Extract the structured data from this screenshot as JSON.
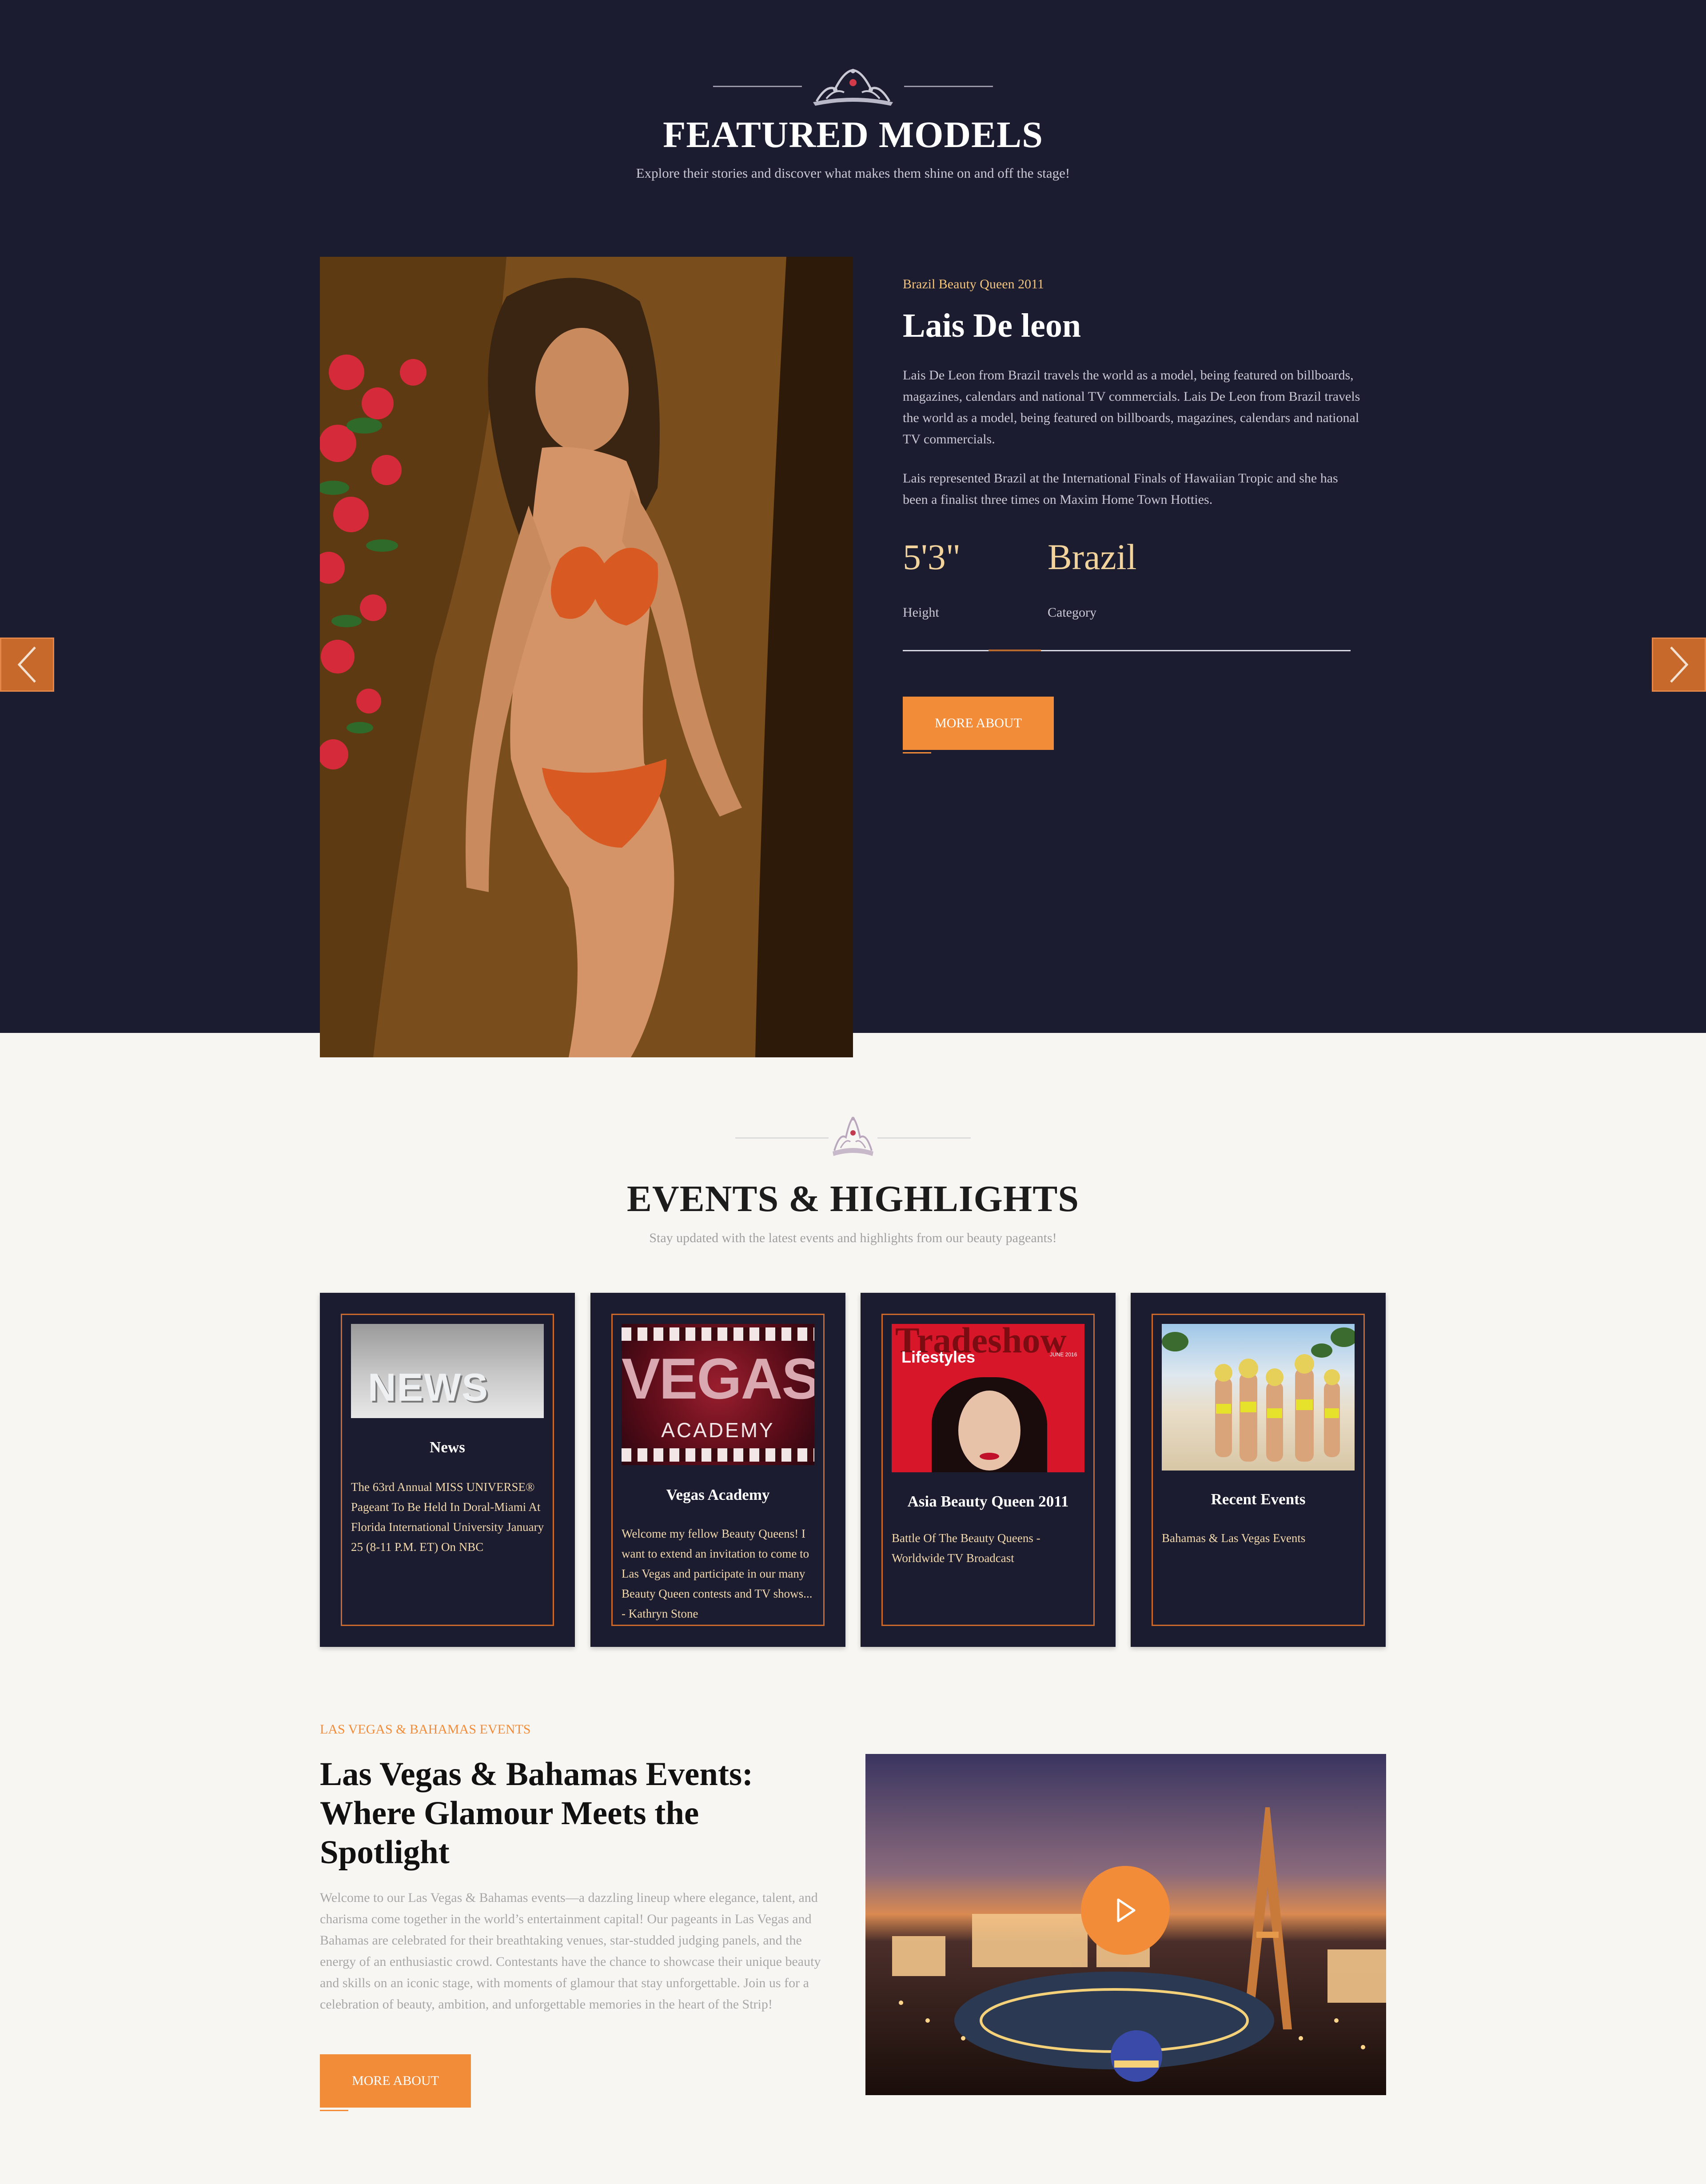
{
  "featured": {
    "title": "FEATURED MODELS",
    "subtitle": "Explore their stories and discover what makes them shine on and off the stage!"
  },
  "model": {
    "kicker": "Brazil Beauty Queen 2011",
    "name": "Lais De leon",
    "bio_1": "Lais De Leon from Brazil travels the world as a model, being featured on billboards, magazines, calendars and national TV commercials. Lais De Leon from Brazil travels the world as a model, being featured on billboards, magazines, calendars and national TV commercials.",
    "bio_2": "Lais represented Brazil at the International Finals of Hawaiian Tropic and she has been a finalist three times on Maxim Home Town Hotties.",
    "height_value": "5'3\"",
    "height_label": "Height",
    "category_value": "Brazil",
    "category_label": "Category",
    "button": "MORE ABOUT"
  },
  "events": {
    "title": "EVENTS & HIGHLIGHTS",
    "subtitle": "Stay updated with the latest events and highlights from our beauty pageants!",
    "cards": [
      {
        "image_text": "NEWS",
        "title": "News",
        "text": "The 63rd Annual MISS UNIVERSE® Pageant To Be Held In Doral-Miami At Florida International University January 25 (8-11 P.M. ET) On NBC"
      },
      {
        "image_text_1": "VEGAS",
        "image_text_2": "ACADEMY",
        "title": "Vegas Academy",
        "text": "Welcome my fellow Beauty Queens! I want to extend an invitation to come to Las Vegas and participate in our many Beauty Queen contests and TV shows... - Kathryn Stone"
      },
      {
        "image_text_1": "Tradeshow",
        "image_text_2": "Lifestyles",
        "image_text_3": "JUNE 2016",
        "title": "Asia Beauty Queen 2011",
        "text": "Battle Of The Beauty Queens - Worldwide TV Broadcast"
      },
      {
        "title": "Recent Events",
        "text": "Bahamas & Las Vegas Events"
      }
    ]
  },
  "lasvegas": {
    "kicker": "LAS VEGAS & BAHAMAS EVENTS",
    "title": "Las Vegas & Bahamas Events: Where Glamour Meets the Spotlight",
    "text": "Welcome to our Las Vegas & Bahamas events—a dazzling lineup where elegance, talent, and charisma come together in the world’s entertainment capital! Our pageants in Las Vegas and Bahamas are celebrated for their breathtaking venues, star-studded judging panels, and the energy of an enthusiastic crowd. Contestants have the chance to showcase their unique beauty and skills on an iconic stage, with moments of glamour that stay unforgettable. Join us for a celebration of beauty, ambition, and unforgettable memories in the heart of the Strip!",
    "button": "MORE ABOUT"
  },
  "colors": {
    "dark_bg": "#1c1c30",
    "accent": "#f28c38",
    "light_bg": "#f8f6f2",
    "gold_text": "#f1d39b"
  },
  "icons": [
    "tiara-icon",
    "chevron-left-icon",
    "chevron-right-icon",
    "play-icon"
  ]
}
